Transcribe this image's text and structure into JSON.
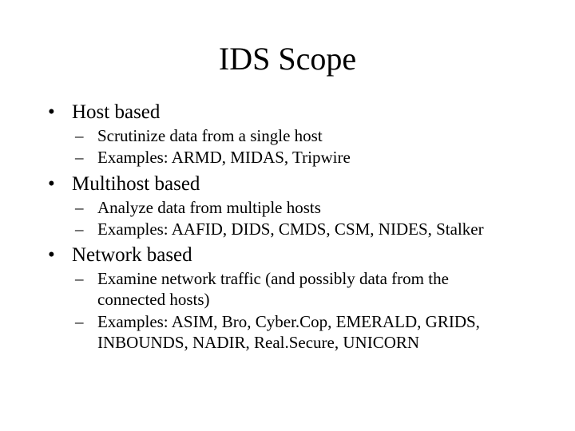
{
  "title": "IDS Scope",
  "bullets": [
    {
      "label": "Host based",
      "subs": [
        "Scrutinize data from a single host",
        "Examples: ARMD, MIDAS, Tripwire"
      ]
    },
    {
      "label": "Multihost based",
      "subs": [
        "Analyze data from multiple hosts",
        "Examples: AAFID, DIDS, CMDS, CSM, NIDES, Stalker"
      ]
    },
    {
      "label": "Network based",
      "subs": [
        "Examine network traffic (and possibly data from the connected hosts)",
        "Examples: ASIM, Bro, Cyber.Cop, EMERALD, GRIDS, INBOUNDS, NADIR, Real.Secure, UNICORN"
      ]
    }
  ],
  "glyphs": {
    "l1": "•",
    "l2": "–"
  }
}
